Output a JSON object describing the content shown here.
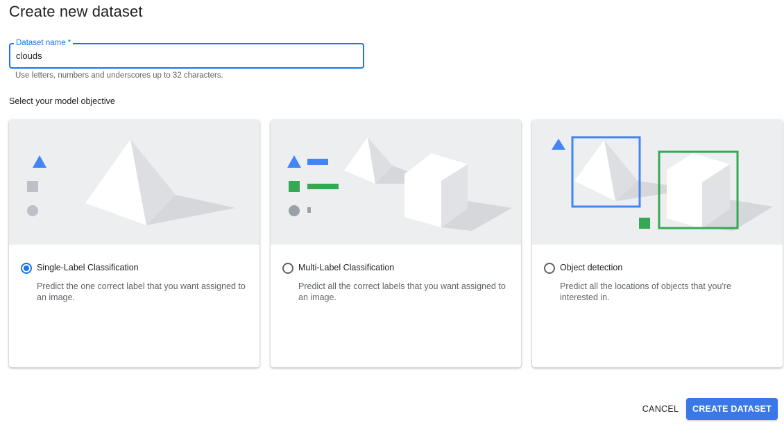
{
  "page": {
    "title": "Create new dataset"
  },
  "form": {
    "name_label": "Dataset name *",
    "name_value": "clouds",
    "name_hint": "Use letters, numbers and underscores up to 32 characters.",
    "objective_label": "Select your model objective"
  },
  "objectives": [
    {
      "title": "Single-Label Classification",
      "description": "Predict the one correct label that you want assigned to an image.",
      "selected": true,
      "illustration": "pyramid-with-shape-legend"
    },
    {
      "title": "Multi-Label Classification",
      "description": "Predict all the correct labels that you want assigned to an image.",
      "selected": false,
      "illustration": "pyramid-and-cube-with-bar-labels"
    },
    {
      "title": "Object detection",
      "description": "Predict all the locations of objects that you're interested in.",
      "selected": false,
      "illustration": "pyramid-and-cube-with-bounding-boxes"
    }
  ],
  "actions": {
    "cancel_label": "CANCEL",
    "create_label": "CREATE DATASET"
  },
  "colors": {
    "accent": "#1a73e8",
    "button": "#3b78e7",
    "blue_shape": "#4285f4",
    "green_shape": "#34a853",
    "gray_shape": "#bdc1c6",
    "illustration_bg": "#eceef0"
  }
}
